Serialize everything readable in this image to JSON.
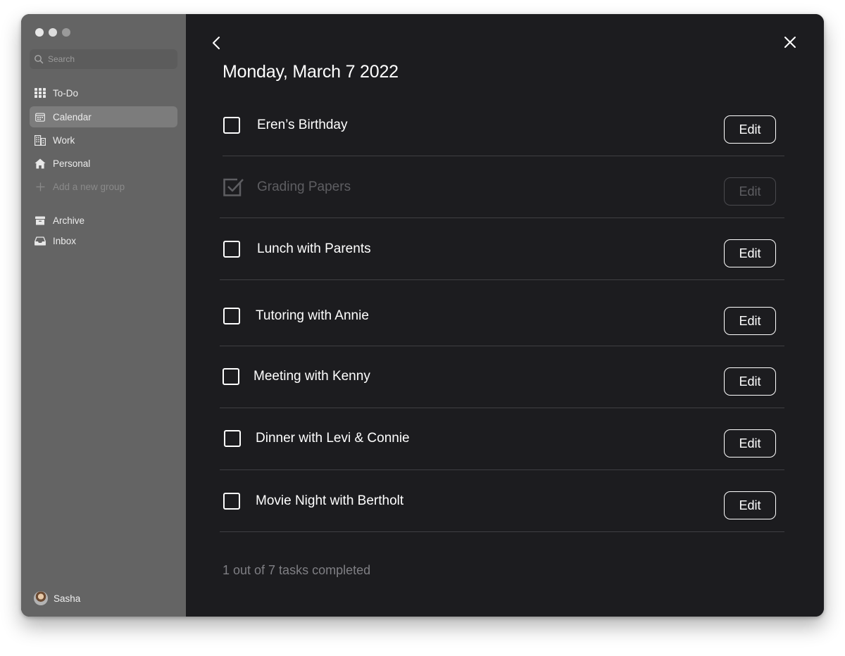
{
  "window": {
    "traffic_lights": [
      "#e8e8e8",
      "#dcdcdc",
      "#9a9a9a"
    ]
  },
  "sidebar": {
    "search": {
      "placeholder": "Search",
      "icon": "search-icon"
    },
    "items": [
      {
        "label": "To-Do",
        "icon": "grid-icon",
        "active": false
      },
      {
        "label": "Calendar",
        "icon": "calendar-icon",
        "active": true
      },
      {
        "label": "Work",
        "icon": "building-icon",
        "active": false
      },
      {
        "label": "Personal",
        "icon": "house-icon",
        "active": false
      },
      {
        "label": "Add a new group",
        "icon": "plus-icon",
        "active": false
      }
    ],
    "secondary_items": [
      {
        "label": "Archive",
        "icon": "archive-box-icon"
      },
      {
        "label": "Inbox",
        "icon": "inbox-tray-icon"
      }
    ],
    "user": {
      "name": "Sasha"
    }
  },
  "main": {
    "back_icon": "chevron-left-icon",
    "close_icon": "close-icon",
    "title": "Monday, March 7 2022",
    "tasks": [
      {
        "label": "Eren’s Birthday",
        "completed": false,
        "edit_label": "Edit"
      },
      {
        "label": "Grading Papers",
        "completed": true,
        "edit_label": "Edit"
      },
      {
        "label": "Lunch with Parents",
        "completed": false,
        "edit_label": "Edit"
      },
      {
        "label": "Tutoring with Annie",
        "completed": false,
        "edit_label": "Edit"
      },
      {
        "label": "Meeting with Kenny",
        "completed": false,
        "edit_label": "Edit"
      },
      {
        "label": "Dinner with Levi & Connie",
        "completed": false,
        "edit_label": "Edit"
      },
      {
        "label": "Movie Night with Bertholt",
        "completed": false,
        "edit_label": "Edit"
      }
    ],
    "status": "1 out of 7 tasks completed"
  },
  "colors": {
    "sidebar_bg": "#646464",
    "main_bg": "#1c1c1f",
    "active_item_bg": "#7c7c7c",
    "text": "#ffffff",
    "muted_text": "#5e5e62"
  }
}
